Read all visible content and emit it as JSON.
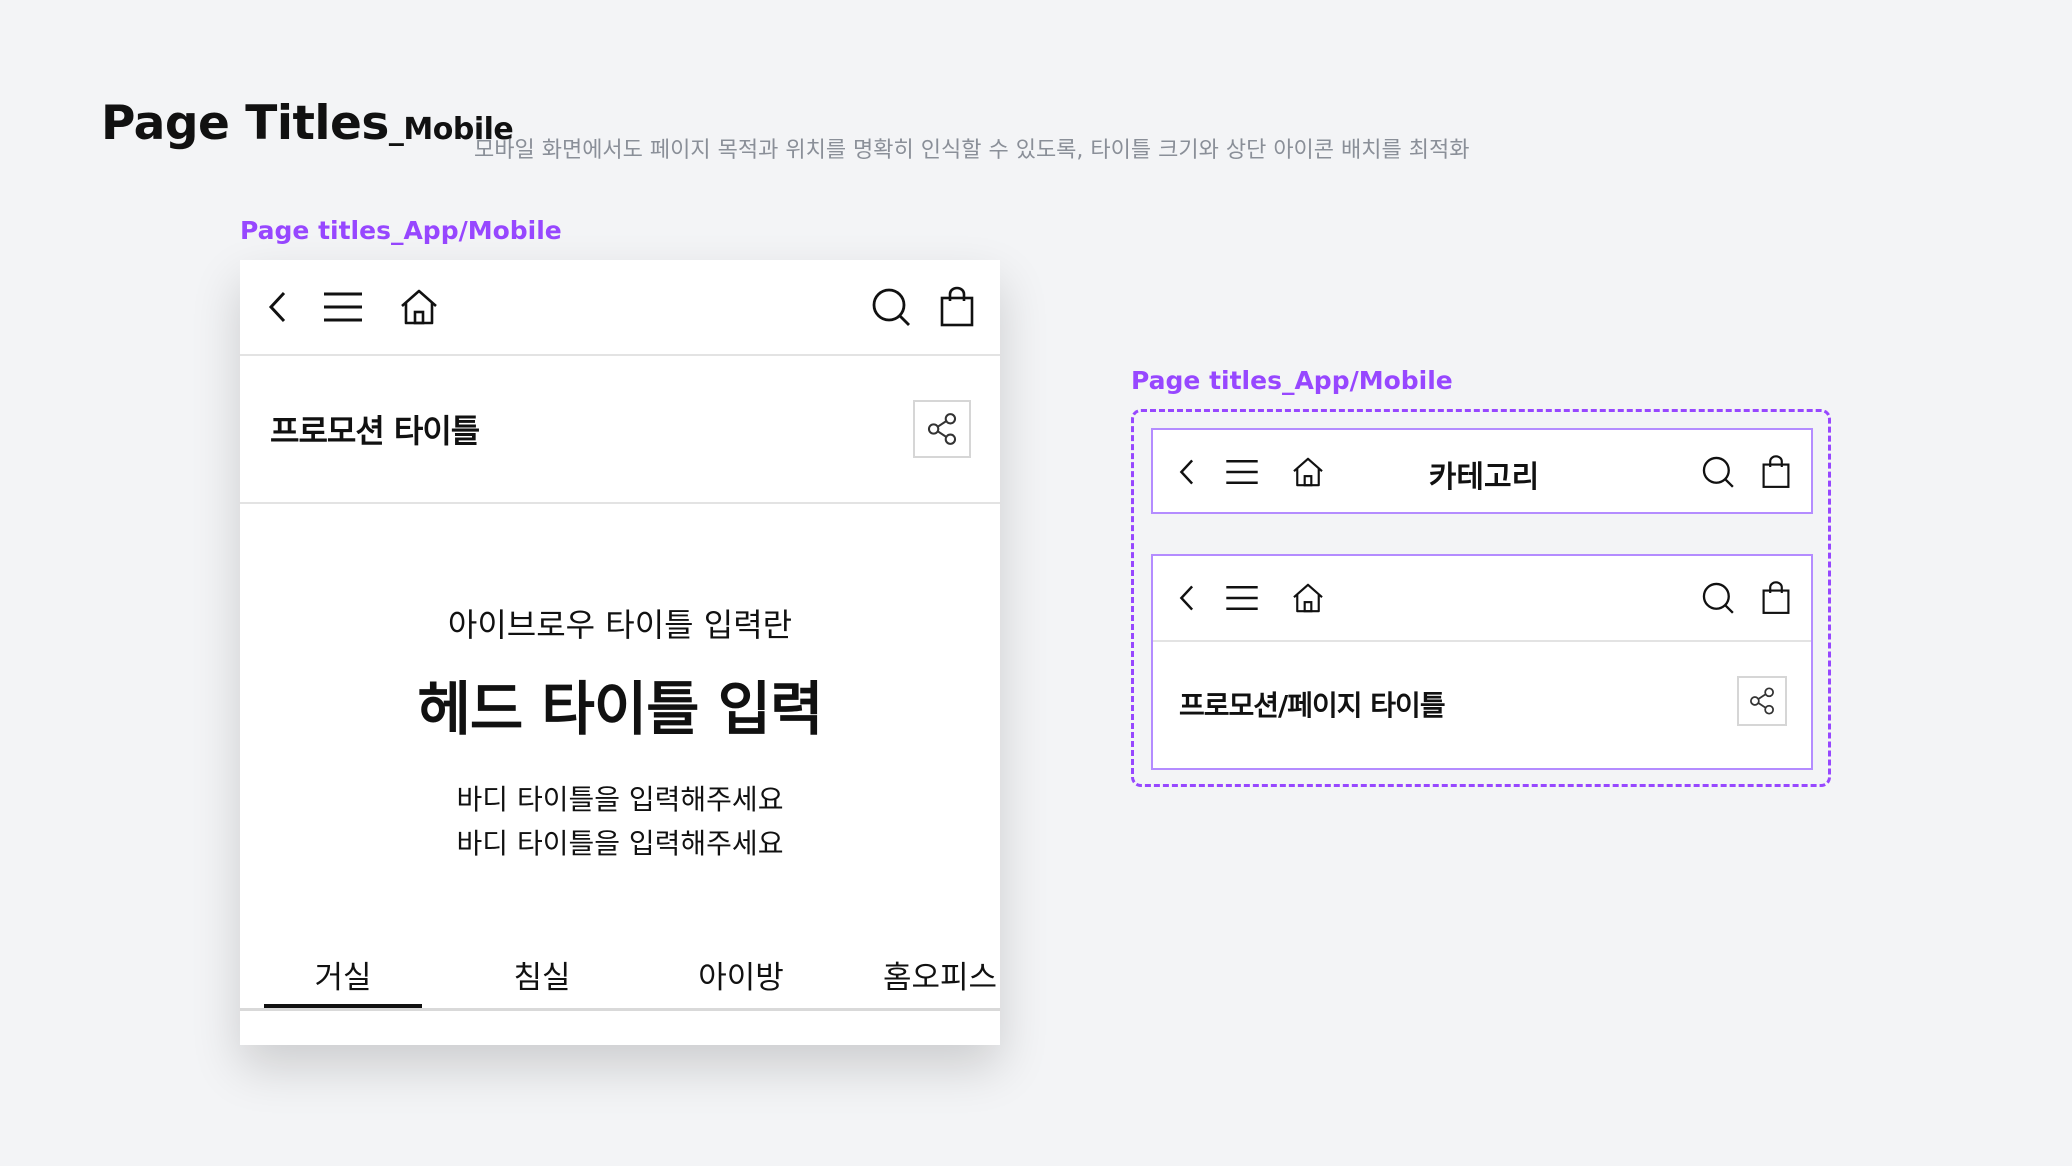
{
  "doc": {
    "title": "Page Titles",
    "title_suffix": "_Mobile",
    "description": "모바일 화면에서도 페이지 목적과 위치를 명확히 인식할 수 있도록, 타이틀 크기와 상단 아이콘 배치를 최적화"
  },
  "left_section": {
    "label": "Page titles_App/Mobile",
    "nav_icons": [
      "back-icon",
      "menu-icon",
      "home-icon",
      "search-icon",
      "shopping-bag-icon"
    ],
    "promo_title": "프로모션 타이틀",
    "share_icon": "share-icon",
    "eyebrow": "아이브로우 타이틀 입력란",
    "head_title": "헤드 타이틀 입력",
    "body_lines": [
      "바디 타이틀을 입력해주세요",
      "바디 타이틀을 입력해주세요"
    ],
    "tabs": [
      {
        "label": "거실",
        "active": true
      },
      {
        "label": "침실",
        "active": false
      },
      {
        "label": "아이방",
        "active": false
      },
      {
        "label": "홈오피스",
        "active": false
      }
    ]
  },
  "right_section": {
    "label": "Page titles_App/Mobile",
    "variant_category": {
      "title": "카테고리"
    },
    "variant_promo": {
      "title": "프로모션/페이지 타이틀"
    }
  },
  "colors": {
    "background": "#f3f4f6",
    "accent": "#9747ff",
    "text": "#111111",
    "muted_text": "#8a8f98",
    "divider": "#e3e3e3"
  }
}
